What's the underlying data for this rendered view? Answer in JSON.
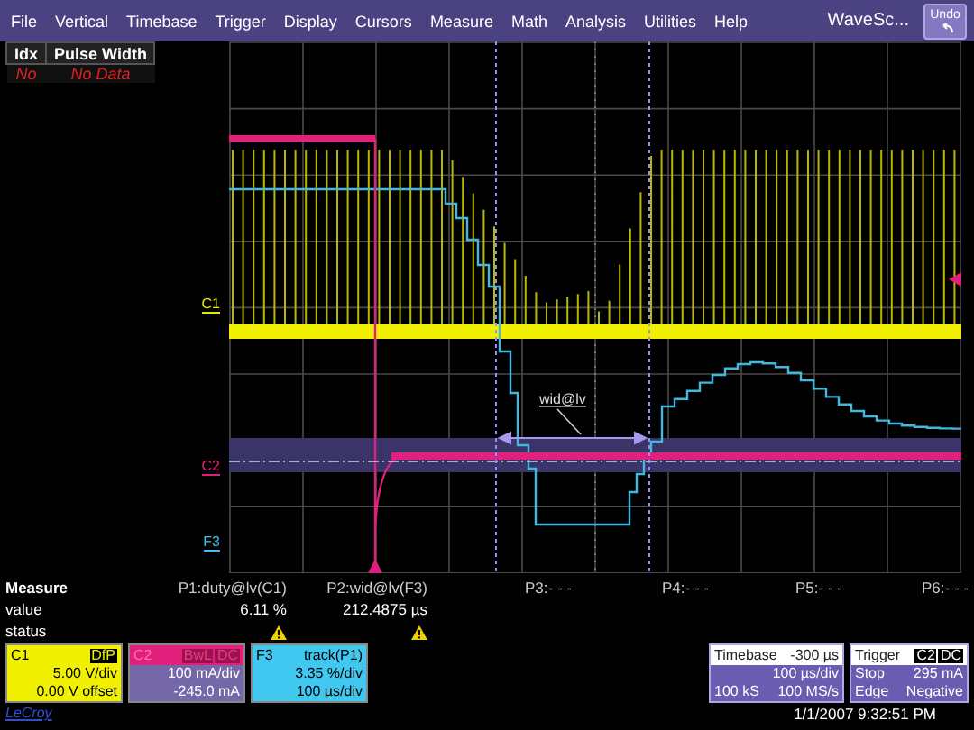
{
  "menu": {
    "items": [
      "File",
      "Vertical",
      "Timebase",
      "Trigger",
      "Display",
      "Cursors",
      "Measure",
      "Math",
      "Analysis",
      "Utilities",
      "Help"
    ],
    "brand": "WaveSc...",
    "undo": "Undo"
  },
  "table": {
    "columns": [
      "Idx",
      "Pulse Width"
    ],
    "rows": [
      [
        "No",
        "No Data"
      ]
    ]
  },
  "grid": {
    "trace_labels": [
      {
        "label": "C1",
        "color": "#e8e800"
      },
      {
        "label": "C2",
        "color": "#e0207a"
      },
      {
        "label": "F3",
        "color": "#40c0f0"
      }
    ],
    "cursor_label": "wid@lv"
  },
  "measure": {
    "title": "Measure",
    "row_labels": [
      "value",
      "status"
    ],
    "params": [
      {
        "name": "P1:duty@lv(C1)",
        "value": "6.11 %",
        "warning": true
      },
      {
        "name": "P2:wid@lv(F3)",
        "value": "212.4875 µs",
        "warning": true
      },
      {
        "name": "P3:- - -",
        "warning": false
      },
      {
        "name": "P4:- - -",
        "warning": false
      },
      {
        "name": "P5:- - -",
        "warning": false
      },
      {
        "name": "P6:- - -",
        "warning": false
      }
    ]
  },
  "channels": [
    {
      "name": "C1",
      "color": "#f0f000",
      "selected": false,
      "badges": [
        "DfP"
      ],
      "lines": [
        "5.00 V/div",
        "0.00 V offset"
      ]
    },
    {
      "name": "C2",
      "color": "#e0207a",
      "selected": true,
      "badges": [
        "BwL",
        "DC"
      ],
      "lines": [
        "100 mA/div",
        "-245.0 mA"
      ]
    },
    {
      "name": "F3",
      "color": "#40c8f0",
      "selected": false,
      "source": "track(P1)",
      "lines": [
        "3.35 %/div",
        "100 µs/div"
      ]
    }
  ],
  "timebase": {
    "title": "Timebase",
    "delay": "-300 µs",
    "per_div": "100 µs/div",
    "samples": "100 kS",
    "rate": "100 MS/s"
  },
  "trigger": {
    "title": "Trigger",
    "badges": [
      "C2",
      "DC"
    ],
    "state": "Stop",
    "threshold": "295 mA",
    "type": "Edge",
    "slope": "Negative"
  },
  "date": "1/1/2007 9:32:51 PM",
  "logo": "LeCroy"
}
